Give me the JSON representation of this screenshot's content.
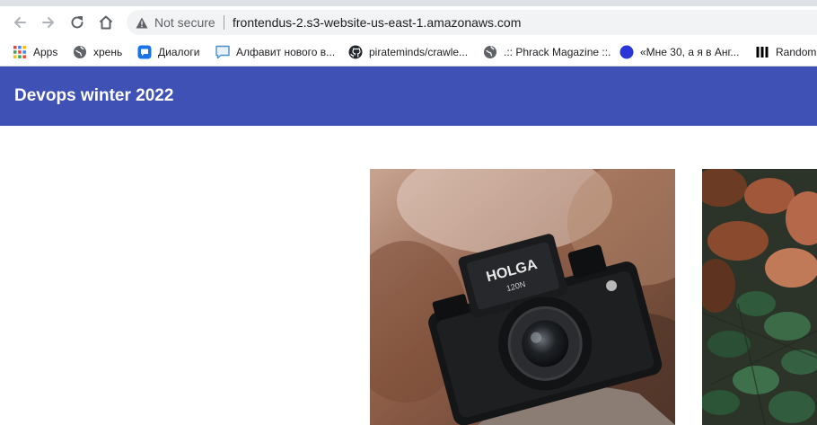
{
  "browser": {
    "security_label": "Not secure",
    "url_host": "frontendus-2.s3-website-us-east-1.amazonaws.com"
  },
  "bookmarks": [
    {
      "label": "Apps",
      "icon": "apps-grid-icon"
    },
    {
      "label": "хрень",
      "icon": "globe-icon"
    },
    {
      "label": "Диалоги",
      "icon": "chat-bubble-icon"
    },
    {
      "label": "Алфавит нового в...",
      "icon": "message-icon"
    },
    {
      "label": "pirateminds/crawle...",
      "icon": "github-icon"
    },
    {
      "label": ".:: Phrack Magazine ::.",
      "icon": "globe-icon"
    },
    {
      "label": "«Мне 30, а я в Анг...",
      "icon": "blue-dot-icon"
    },
    {
      "label": "Random",
      "icon": "bars-icon"
    }
  ],
  "header": {
    "title": "Devops winter 2022"
  },
  "gallery": {
    "photo_1_icon": "holga-camera-photo",
    "photo_1_text": "HOLGA",
    "photo_1_subtext": "120N",
    "photo_2_icon": "autumn-leaves-photo"
  },
  "colors": {
    "appbar": "#3f51b5",
    "appbar_text": "#ffffff"
  }
}
